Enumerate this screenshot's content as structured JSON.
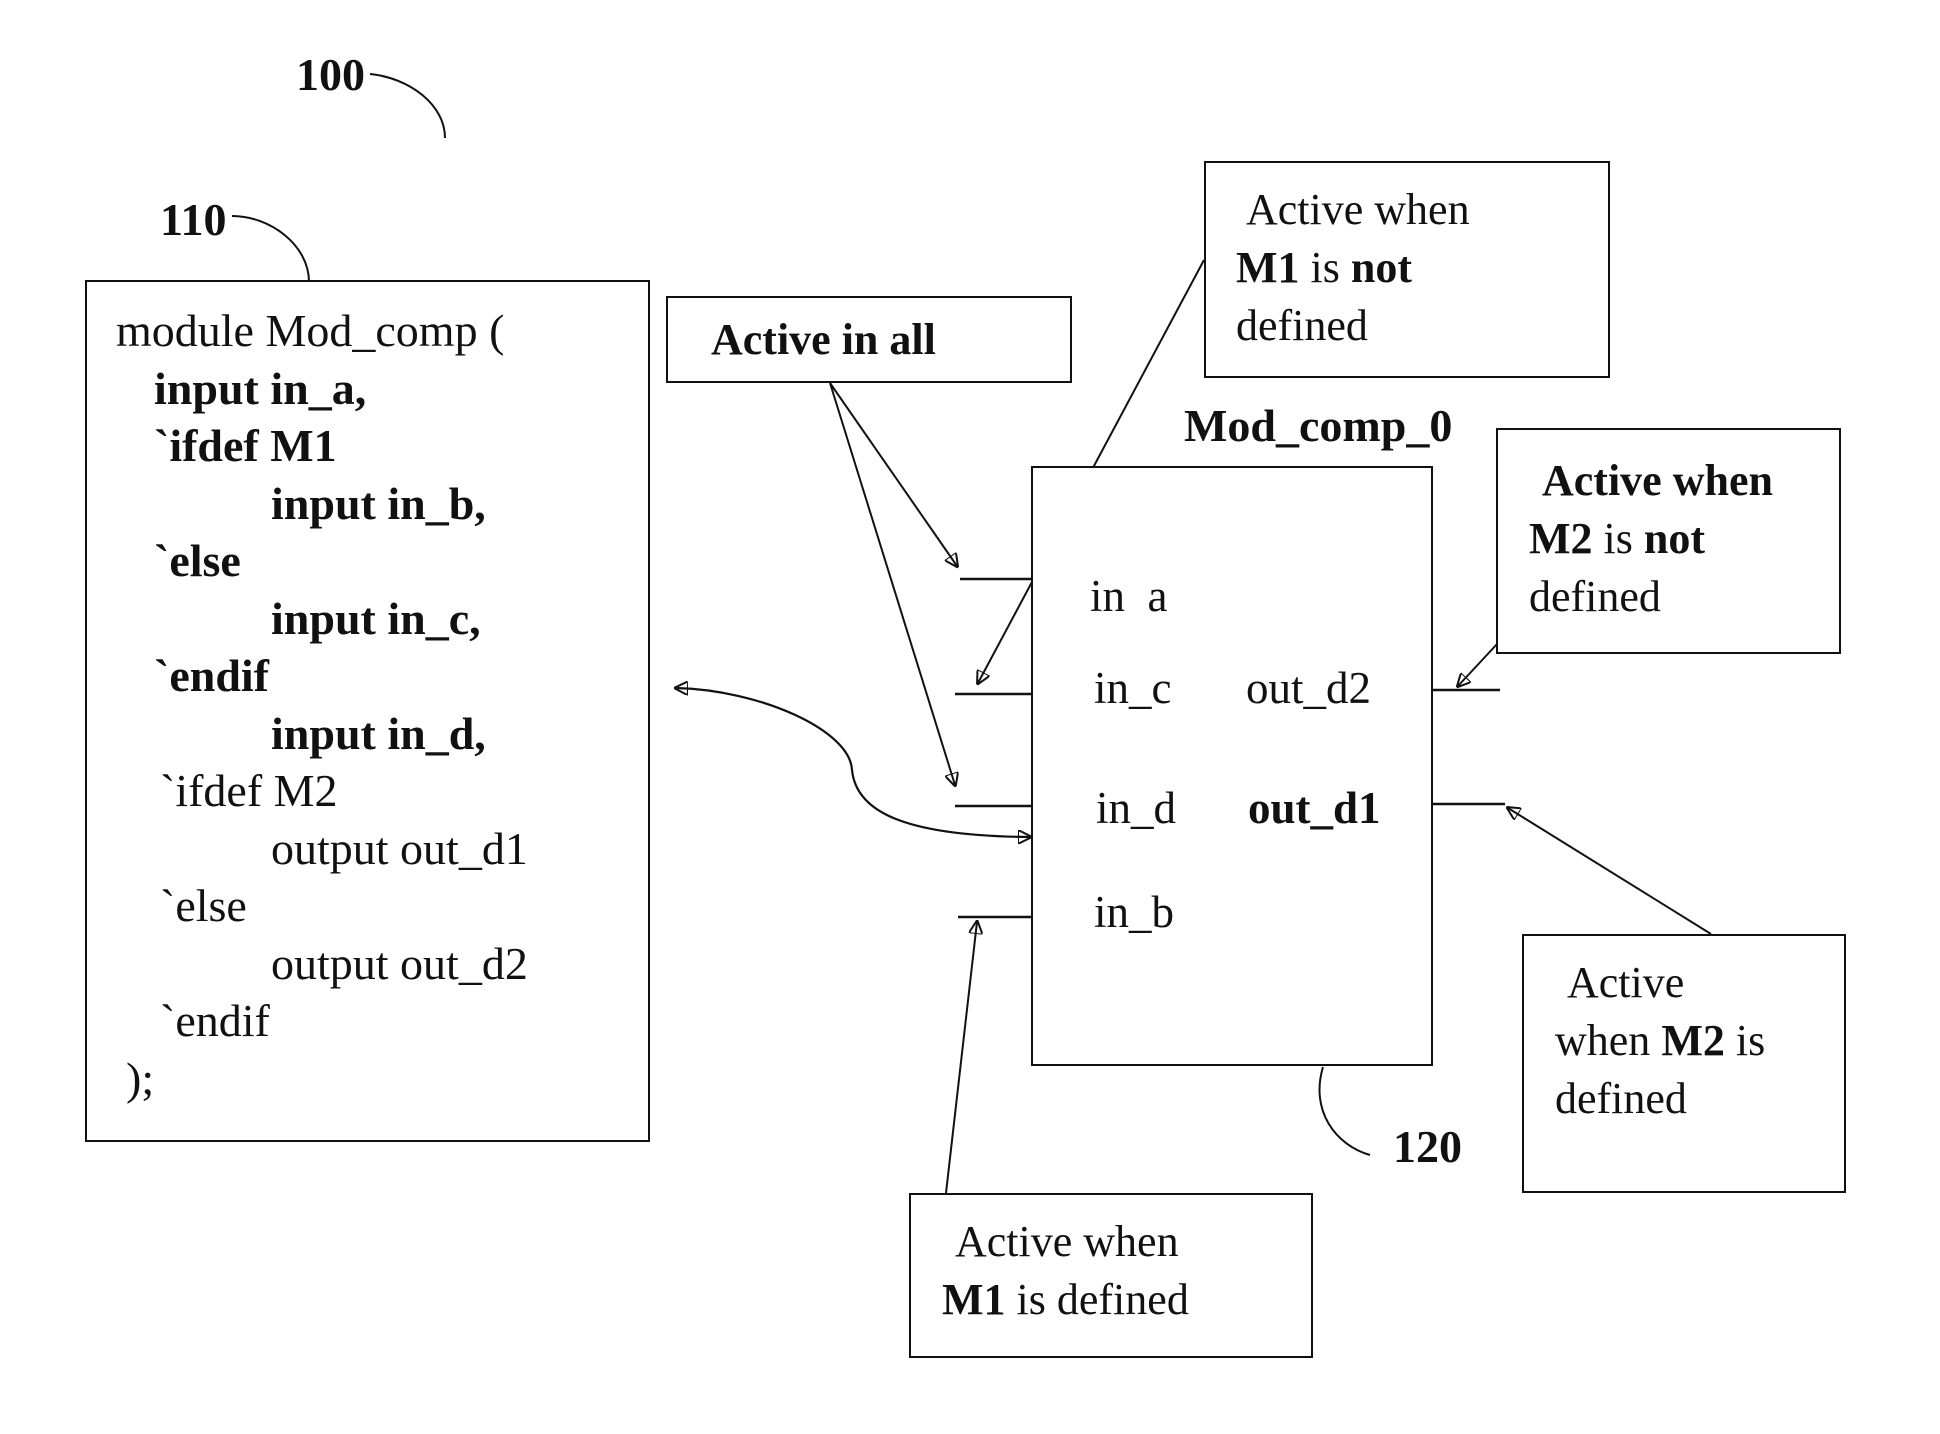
{
  "figure": {
    "ref_main": "100",
    "ref_code": "110",
    "ref_module": "120"
  },
  "code": {
    "lines": [
      {
        "text": "module Mod_comp (",
        "bold": false
      },
      {
        "text": "input in_a,",
        "bold": true
      },
      {
        "text": "`ifdef M1",
        "bold": true
      },
      {
        "text": "input in_b,",
        "bold": true
      },
      {
        "text": "`else",
        "bold": true
      },
      {
        "text": "input in_c,",
        "bold": true
      },
      {
        "text": "`endif",
        "bold": true
      },
      {
        "text": "input in_d,",
        "bold": true
      },
      {
        "text": "`ifdef M2",
        "bold": false
      },
      {
        "text": "output out_d1",
        "bold": false
      },
      {
        "text": "`else",
        "bold": false
      },
      {
        "text": "output out_d2",
        "bold": false
      },
      {
        "text": "`endif",
        "bold": false
      },
      {
        "text": ");",
        "bold": false
      }
    ]
  },
  "module": {
    "name": "Mod_comp_0",
    "inputs": [
      "in_a",
      "in_c",
      "in_d",
      "in_b"
    ],
    "in_a_display": "in  a",
    "outputs": [
      "out_d2",
      "out_d1"
    ]
  },
  "notes": {
    "active_in_all": "Active in all",
    "m1_not_defined": {
      "l1": "Active when",
      "l2a": "M1",
      "l2b": " is ",
      "l2c": "not",
      "l3": "defined"
    },
    "m2_not_defined": {
      "l1": "Active when",
      "l2a": "M2",
      "l2b": " is ",
      "l2c": "not",
      "l3": "defined"
    },
    "m2_defined": {
      "l1": "Active",
      "l2a": "when ",
      "l2b": "M2",
      "l2c": " is",
      "l3": "defined"
    },
    "m1_defined": {
      "l1": "Active when",
      "l2a": "M1",
      "l2b": " is defined"
    }
  }
}
